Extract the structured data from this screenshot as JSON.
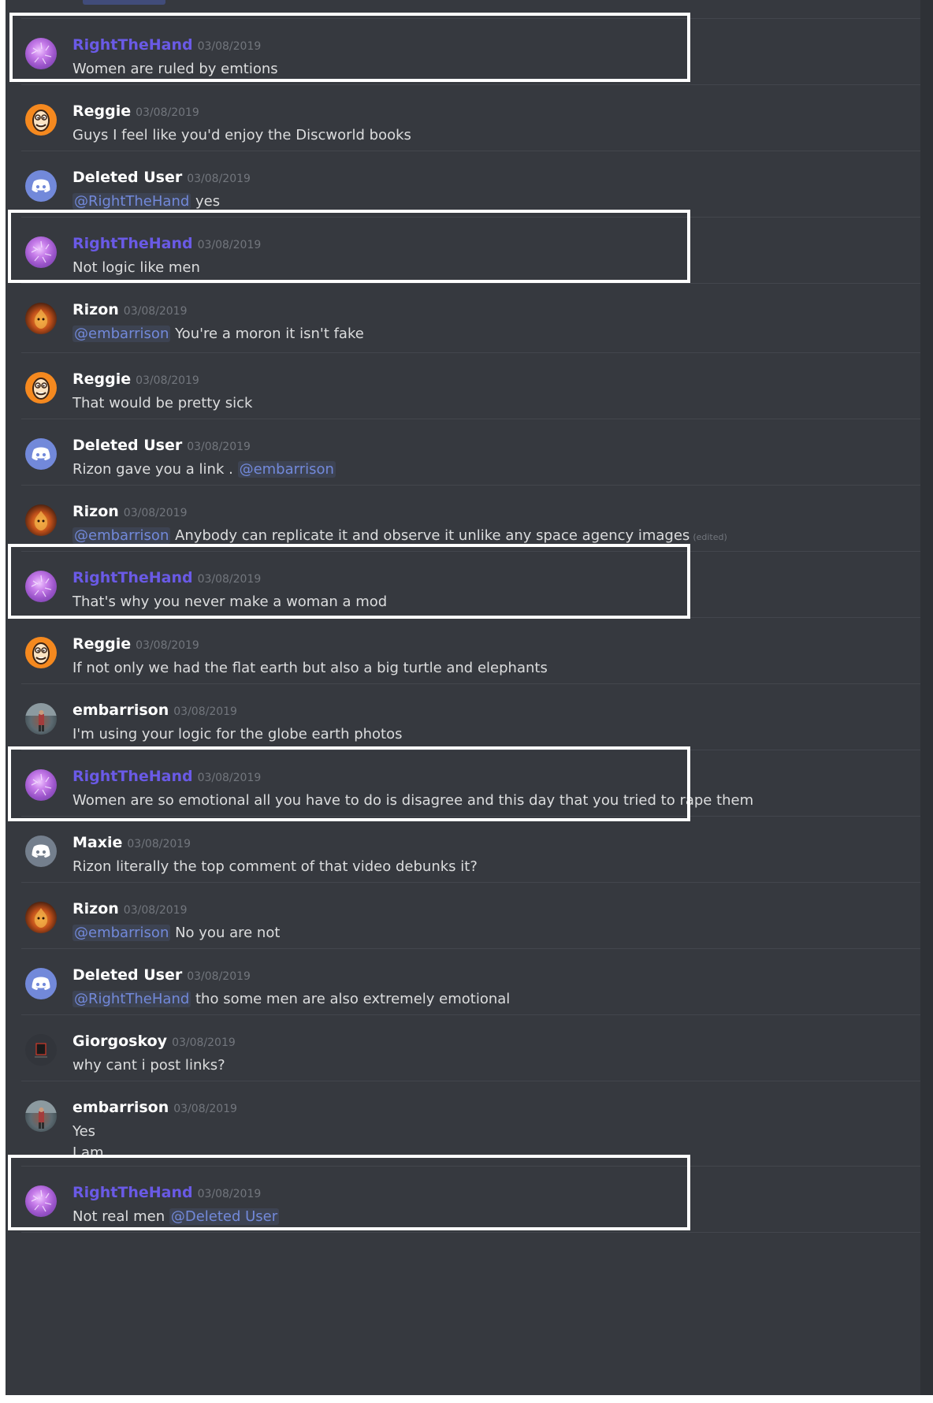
{
  "messages": [
    {
      "author": "RightTheHand",
      "timestamp": "03/08/2019",
      "lines": [
        [
          {
            "t": "text",
            "v": "Women are ruled by emtions"
          }
        ]
      ]
    },
    {
      "author": "Reggie",
      "timestamp": "03/08/2019",
      "lines": [
        [
          {
            "t": "text",
            "v": "Guys I feel like you'd enjoy the Discworld books"
          }
        ]
      ]
    },
    {
      "author": "Deleted User",
      "timestamp": "03/08/2019",
      "lines": [
        [
          {
            "t": "mention",
            "v": "@RightTheHand"
          },
          {
            "t": "text",
            "v": " yes"
          }
        ]
      ]
    },
    {
      "author": "RightTheHand",
      "timestamp": "03/08/2019",
      "lines": [
        [
          {
            "t": "text",
            "v": "Not logic like men"
          }
        ]
      ]
    },
    {
      "author": "Rizon",
      "timestamp": "03/08/2019",
      "lines": [
        [
          {
            "t": "mention",
            "v": "@embarrison"
          },
          {
            "t": "text",
            "v": " You're a moron it isn't fake"
          }
        ]
      ]
    },
    {
      "author": "Reggie",
      "timestamp": "03/08/2019",
      "lines": [
        [
          {
            "t": "text",
            "v": "That would be pretty sick"
          }
        ]
      ]
    },
    {
      "author": "Deleted User",
      "timestamp": "03/08/2019",
      "lines": [
        [
          {
            "t": "text",
            "v": "Rizon gave you a link .  "
          },
          {
            "t": "mention",
            "v": "@embarrison"
          }
        ]
      ]
    },
    {
      "author": "Rizon",
      "timestamp": "03/08/2019",
      "lines": [
        [
          {
            "t": "mention",
            "v": "@embarrison"
          },
          {
            "t": "text",
            "v": " Anybody can replicate it and observe it unlike any space agency images"
          },
          {
            "t": "edited",
            "v": "(edited)"
          }
        ]
      ]
    },
    {
      "author": "RightTheHand",
      "timestamp": "03/08/2019",
      "lines": [
        [
          {
            "t": "text",
            "v": "That's why you never make a woman a mod"
          }
        ]
      ]
    },
    {
      "author": "Reggie",
      "timestamp": "03/08/2019",
      "lines": [
        [
          {
            "t": "text",
            "v": "If not only we had the flat earth but also a big turtle and elephants"
          }
        ]
      ]
    },
    {
      "author": "embarrison",
      "timestamp": "03/08/2019",
      "lines": [
        [
          {
            "t": "text",
            "v": "I'm using your logic for the globe earth photos"
          }
        ]
      ]
    },
    {
      "author": "RightTheHand",
      "timestamp": "03/08/2019",
      "lines": [
        [
          {
            "t": "text",
            "v": "Women are so emotional all you have to do is disagree and this day that you tried to rape them"
          }
        ]
      ]
    },
    {
      "author": "Maxie",
      "timestamp": "03/08/2019",
      "lines": [
        [
          {
            "t": "text",
            "v": "Rizon literally the top comment of that video debunks it?"
          }
        ]
      ]
    },
    {
      "author": "Rizon",
      "timestamp": "03/08/2019",
      "lines": [
        [
          {
            "t": "mention",
            "v": "@embarrison"
          },
          {
            "t": "text",
            "v": " No you are not"
          }
        ]
      ]
    },
    {
      "author": "Deleted User",
      "timestamp": "03/08/2019",
      "lines": [
        [
          {
            "t": "mention",
            "v": "@RightTheHand"
          },
          {
            "t": "text",
            "v": " tho some men are also extremely emotional"
          }
        ]
      ]
    },
    {
      "author": "Giorgoskoy",
      "timestamp": "03/08/2019",
      "lines": [
        [
          {
            "t": "text",
            "v": "why cant i post links?"
          }
        ]
      ]
    },
    {
      "author": "embarrison",
      "timestamp": "03/08/2019",
      "lines": [
        [
          {
            "t": "text",
            "v": "Yes"
          }
        ],
        [
          {
            "t": "text",
            "v": "I am"
          }
        ]
      ]
    },
    {
      "author": "RightTheHand",
      "timestamp": "03/08/2019",
      "lines": [
        [
          {
            "t": "text",
            "v": "Not real men "
          },
          {
            "t": "mention",
            "v": "@Deleted User"
          }
        ]
      ]
    }
  ],
  "colors": {
    "background": "#36393f",
    "highlighted_author": "#6a5ae6",
    "mention": "#7289da",
    "highlight_box": "#ffffff"
  }
}
